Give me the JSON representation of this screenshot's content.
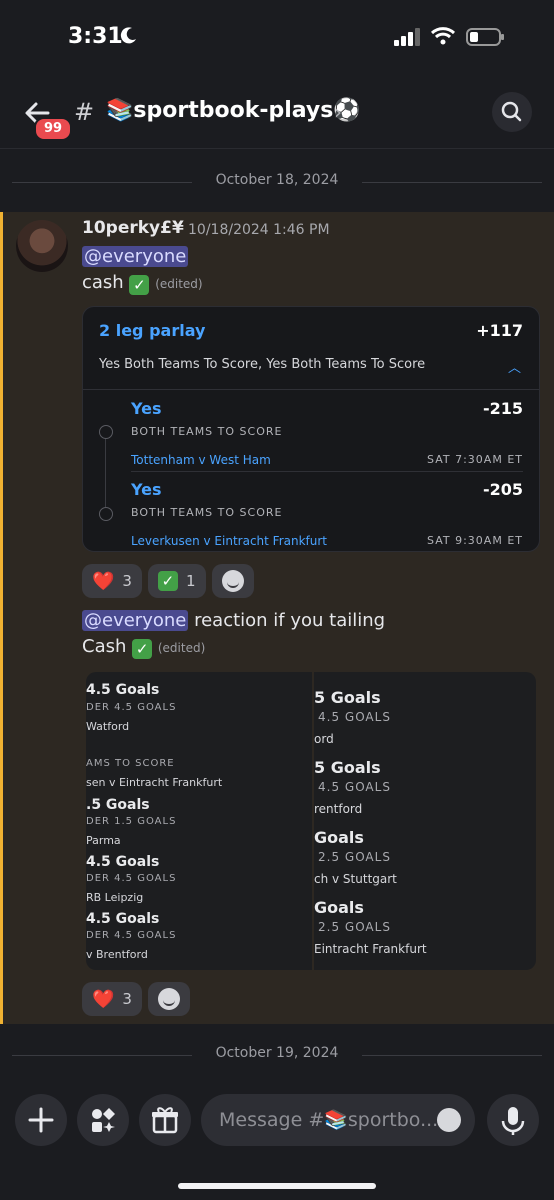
{
  "status": {
    "time": "3:31"
  },
  "header": {
    "badge": "99",
    "channel": "📚sportbook-plays⚽",
    "chevron": "›"
  },
  "dividers": {
    "first": "October 18, 2024",
    "second": "October 19, 2024"
  },
  "message": {
    "author": "10perky£¥",
    "timestamp": "10/18/2024 1:46 PM",
    "mention1": "@everyone",
    "line1": "cash",
    "edited": "(edited)",
    "mention2": "@everyone",
    "line2_rest": " reaction if you tailing",
    "line3": "Cash"
  },
  "parlay": {
    "title": "2 leg parlay",
    "odds": "+117",
    "summary": "Yes Both Teams To Score, Yes Both Teams To Score",
    "legs": [
      {
        "pick": "Yes",
        "market": "BOTH TEAMS TO SCORE",
        "game": "Tottenham v West Ham",
        "odds": "-215",
        "time": "SAT 7:30AM ET"
      },
      {
        "pick": "Yes",
        "market": "BOTH TEAMS TO SCORE",
        "game": "Leverkusen v Eintracht Frankfurt",
        "odds": "-205",
        "time": "SAT 9:30AM ET"
      }
    ]
  },
  "reactions1": [
    {
      "emoji": "❤️",
      "count": "3"
    },
    {
      "emoji": "✅",
      "count": "1"
    }
  ],
  "reactions2": [
    {
      "emoji": "❤️",
      "count": "3"
    }
  ],
  "image_left": [
    {
      "title": "4.5 Goals",
      "sub": "DER 4.5 GOALS",
      "team": "Watford"
    },
    {
      "title": "",
      "sub": "AMS TO SCORE",
      "team": "sen v Eintracht Frankfurt"
    },
    {
      "title": ".5 Goals",
      "sub": "DER 1.5 GOALS",
      "team": "Parma"
    },
    {
      "title": "4.5 Goals",
      "sub": "DER 4.5 GOALS",
      "team": "RB Leipzig"
    },
    {
      "title": "4.5 Goals",
      "sub": "DER 4.5 GOALS",
      "team": "v Brentford"
    }
  ],
  "image_right": [
    {
      "title": "5 Goals",
      "sub": "4.5 GOALS",
      "team": "ord"
    },
    {
      "title": "5 Goals",
      "sub": "4.5 GOALS",
      "team": "rentford"
    },
    {
      "title": "Goals",
      "sub": "2.5 GOALS",
      "team": "ch v Stuttgart"
    },
    {
      "title": "Goals",
      "sub": "2.5 GOALS",
      "team": "Eintracht Frankfurt"
    }
  ],
  "composer": {
    "placeholder": "Message #📚sportbo..."
  },
  "colors": {
    "accent": "#4aa3ff",
    "highlight_bar": "#f0b232",
    "badge": "#ea4a4f"
  }
}
